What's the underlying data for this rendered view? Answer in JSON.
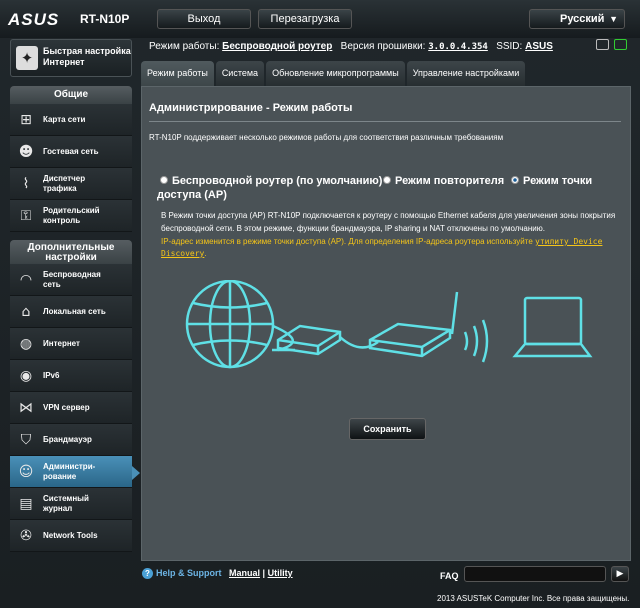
{
  "header": {
    "brand": "ASUS",
    "model": "RT-N10P",
    "logout_label": "Выход",
    "reboot_label": "Перезагрузка",
    "language": "Русский"
  },
  "status": {
    "mode_label": "Режим работы:",
    "mode_value": "Беспроводной роутер",
    "firmware_label": "Версия прошивки:",
    "firmware_value": "3.0.0.4.354",
    "ssid_label": "SSID:",
    "ssid_value": "ASUS"
  },
  "sidebar": {
    "quick_setup": {
      "line1": "Быстрая настройка",
      "line2": "Интернет",
      "icon": "wand-icon"
    },
    "general_title": "Общие",
    "general_items": [
      {
        "line1": "Карта сети",
        "line2": "",
        "icon": "network-map-icon"
      },
      {
        "line1": "Гостевая сеть",
        "line2": "",
        "icon": "guest-network-icon"
      },
      {
        "line1": "Диспетчер",
        "line2": "трафика",
        "icon": "traffic-icon"
      },
      {
        "line1": "Родительский",
        "line2": "контроль",
        "icon": "parental-icon"
      }
    ],
    "advanced_title_line1": "Дополнительные",
    "advanced_title_line2": "настройки",
    "advanced_items": [
      {
        "line1": "Беспроводная",
        "line2": "сеть",
        "icon": "wifi-icon"
      },
      {
        "line1": "Локальная сеть",
        "line2": "",
        "icon": "home-icon"
      },
      {
        "line1": "Интернет",
        "line2": "",
        "icon": "globe-icon"
      },
      {
        "line1": "IPv6",
        "line2": "",
        "icon": "ipv6-icon"
      },
      {
        "line1": "VPN сервер",
        "line2": "",
        "icon": "vpn-icon"
      },
      {
        "line1": "Брандмауэр",
        "line2": "",
        "icon": "firewall-icon"
      },
      {
        "line1": "Администри-",
        "line2": "рование",
        "icon": "admin-icon"
      },
      {
        "line1": "Системный",
        "line2": "журнал",
        "icon": "log-icon"
      },
      {
        "line1": "Network Tools",
        "line2": "",
        "icon": "tools-icon"
      }
    ]
  },
  "tabs": [
    {
      "label": "Режим работы"
    },
    {
      "label": "Система"
    },
    {
      "label": "Обновление микропрограммы"
    },
    {
      "label": "Управление настройками"
    }
  ],
  "main": {
    "title": "Администрирование - Режим работы",
    "description": "RT-N10P поддерживает несколько режимов работы для соответствия различным требованиям",
    "radio_router": "Беспроводной роутер (по умолчанию)",
    "radio_repeater": "Режим повторителя",
    "radio_ap_line1": "Режим точки",
    "radio_ap_line2": "доступа (AP)",
    "mode_desc_1": "В Режим точки доступа (AP) RT-N10P подключается к роутеру с помощью Ethernet кабеля для увеличения зоны покрытия",
    "mode_desc_2": "беспроводной сети. В этом режиме, функции брандмауэра, IP sharing и NAT отключены по умолчанию.",
    "note_text": "IP-адрес изменится в режиме точки доступа (AP). Для определения IP-адреса роутера используйте",
    "note_link_1": "утилиту Device",
    "note_link_2": "Discovery",
    "note_end": ".",
    "apply_label": "Сохранить"
  },
  "footer": {
    "help_label": "Help & Support",
    "manual_label": "Manual",
    "divider": "|",
    "utility_label": "Utility",
    "faq_label": "FAQ",
    "copyright": "2013  ASUSTeK Computer Inc. Все права защищены."
  },
  "colors": {
    "accent": "#2a6688",
    "highlight": "#6cb4e4",
    "warning": "#f5c518",
    "diagram": "#5fe0e6"
  }
}
